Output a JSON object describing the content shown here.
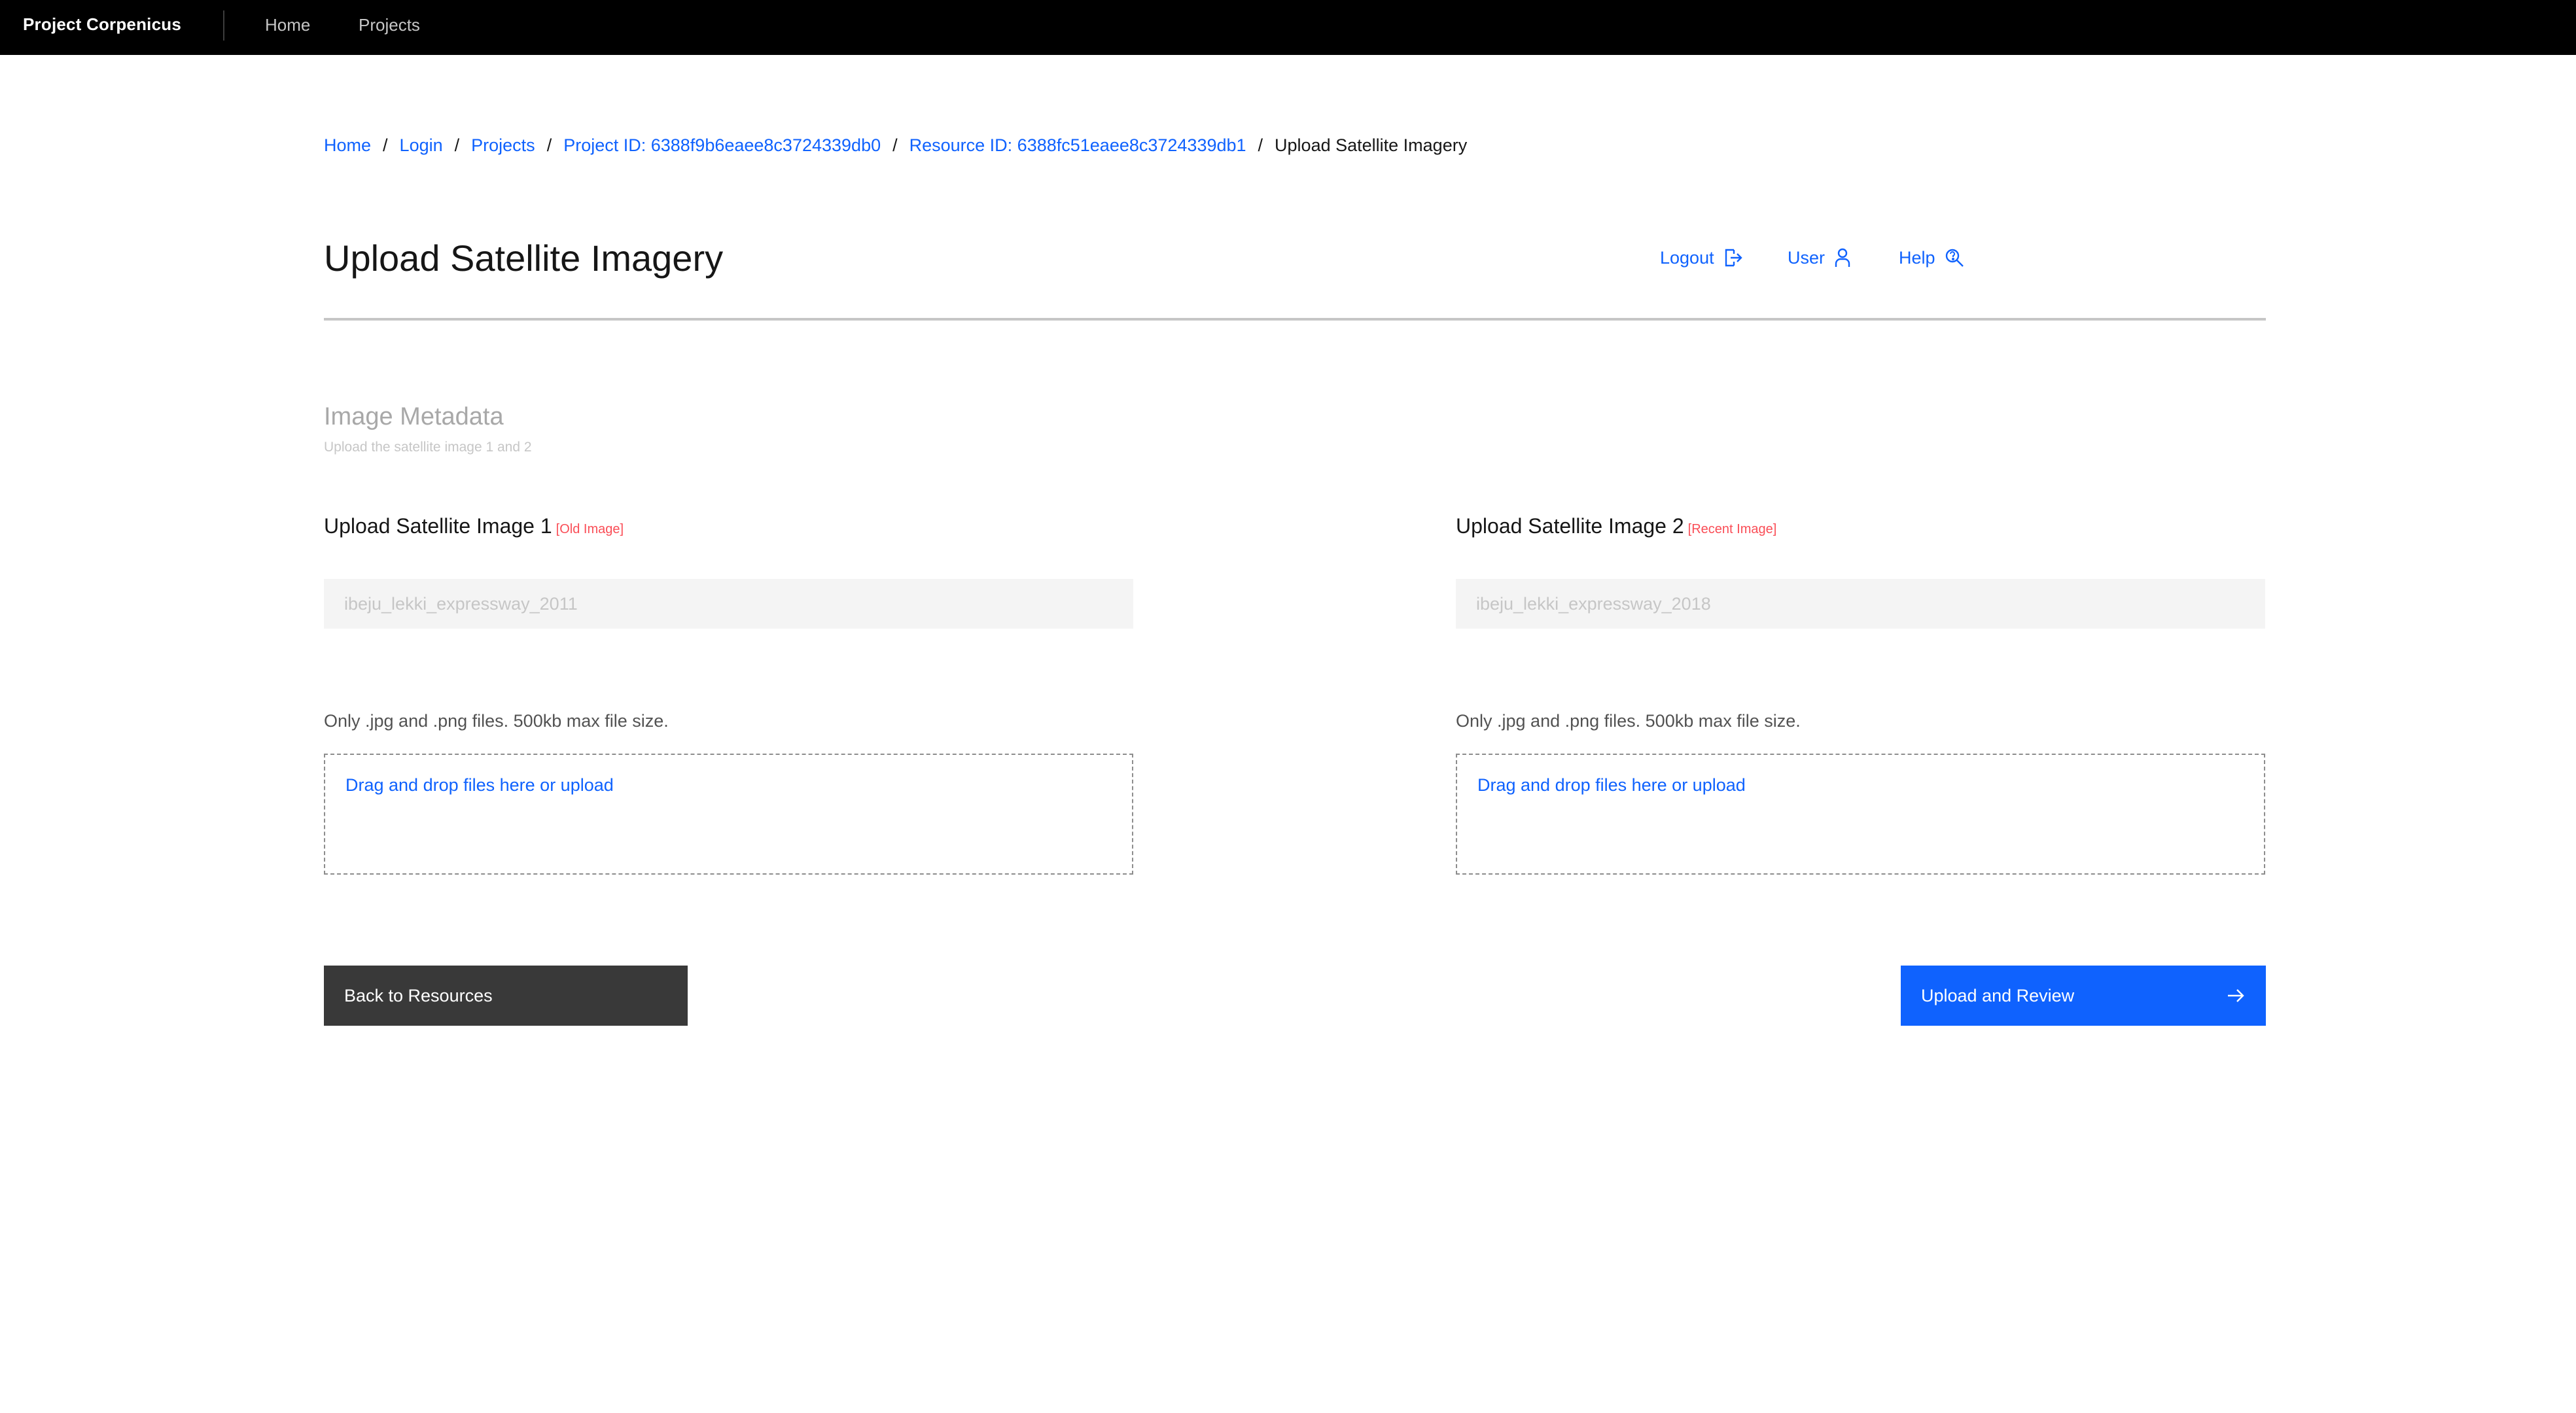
{
  "topnav": {
    "brand": "Project Corpenicus",
    "links": [
      {
        "label": "Home"
      },
      {
        "label": "Projects"
      }
    ]
  },
  "breadcrumb": {
    "items": [
      {
        "label": "Home"
      },
      {
        "label": "Login"
      },
      {
        "label": "Projects"
      },
      {
        "label": "Project ID: 6388f9b6eaee8c3724339db0"
      },
      {
        "label": "Resource ID: 6388fc51eaee8c3724339db1"
      }
    ],
    "separator": "/",
    "current": "Upload Satellite Imagery"
  },
  "header": {
    "title": "Upload Satellite Imagery",
    "actions": [
      {
        "label": "Logout",
        "icon": "logout-icon"
      },
      {
        "label": "User",
        "icon": "user-icon"
      },
      {
        "label": "Help",
        "icon": "help-search-icon"
      }
    ]
  },
  "section": {
    "title": "Image Metadata",
    "subtitle": "Upload the satellite image 1 and 2"
  },
  "uploads": [
    {
      "label": "Upload Satellite Image 1",
      "tag": "[Old Image]",
      "placeholder": "ibeju_lekki_expressway_2011",
      "helper": "Only .jpg and .png files. 500kb max file size.",
      "dropzone": "Drag and drop files here or upload"
    },
    {
      "label": "Upload Satellite Image 2",
      "tag": "[Recent Image]",
      "placeholder": "ibeju_lekki_expressway_2018",
      "helper": "Only .jpg and .png files. 500kb max file size.",
      "dropzone": "Drag and drop files here or upload"
    }
  ],
  "buttons": {
    "back": "Back to Resources",
    "upload": "Upload and Review",
    "upload_icon": "arrow-right-icon"
  },
  "colors": {
    "accent": "#0f62fe",
    "danger_tag": "#fa4d56",
    "nav_bg": "#000000",
    "secondary_button": "#393939"
  }
}
